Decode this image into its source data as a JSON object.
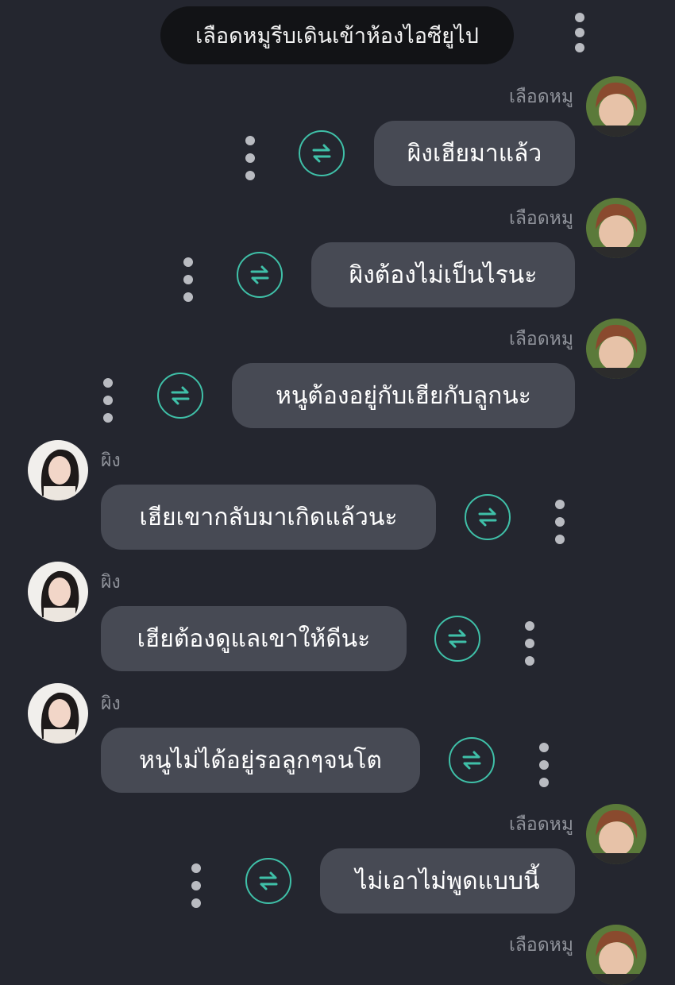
{
  "narration": "เลือดหมูรีบเดินเข้าห้องไอซียูไป",
  "colors": {
    "background": "#24262f",
    "bubble": "#474a54",
    "accent": "#3fc0a8",
    "pill": "#121316"
  },
  "icons": {
    "menu": "more-vertical-icon",
    "swap": "swap-arrows-icon"
  },
  "messages": [
    {
      "sender": "เลือดหมู",
      "side": "right",
      "text": "ผิงเฮียมาแล้ว"
    },
    {
      "sender": "เลือดหมู",
      "side": "right",
      "text": "ผิงต้องไม่เป็นไรนะ"
    },
    {
      "sender": "เลือดหมู",
      "side": "right",
      "text": "หนูต้องอยู่กับเฮียกับลูกนะ"
    },
    {
      "sender": "ผิง",
      "side": "left",
      "text": "เฮียเขากลับมาเกิดแล้วนะ"
    },
    {
      "sender": "ผิง",
      "side": "left",
      "text": "เฮียต้องดูแลเขาให้ดีนะ"
    },
    {
      "sender": "ผิง",
      "side": "left",
      "text": "หนูไม่ได้อยู่รอลูกๆจนโต"
    },
    {
      "sender": "เลือดหมู",
      "side": "right",
      "text": "ไม่เอาไม่พูดแบบนี้"
    },
    {
      "sender": "เลือดหมู",
      "side": "right",
      "text": ""
    }
  ]
}
